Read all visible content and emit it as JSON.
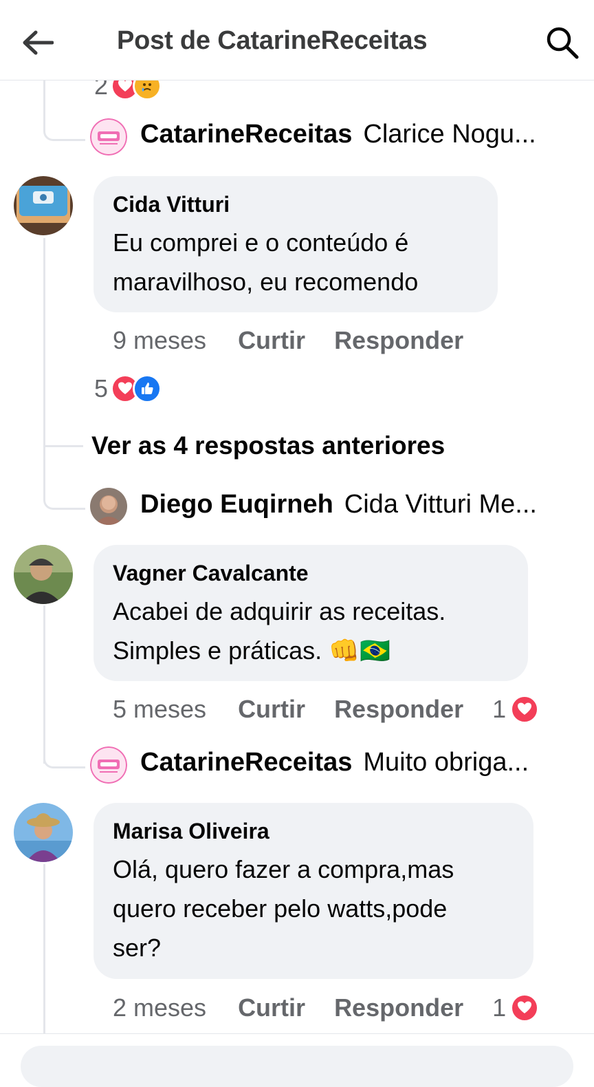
{
  "header": {
    "title": "Post de CatarineReceitas"
  },
  "top_partial": {
    "reaction_count": "2"
  },
  "replies": {
    "catarine_1": {
      "name": "CatarineReceitas",
      "text": "Clarice Nogu..."
    },
    "diego": {
      "name": "Diego Euqirneh",
      "text": "Cida Vitturi Me..."
    },
    "catarine_2": {
      "name": "CatarineReceitas",
      "text": "Muito obriga..."
    }
  },
  "comments": [
    {
      "author": "Cida Vitturi",
      "line1": "Eu comprei e o conteúdo é",
      "line2": "maravilhoso, eu recomendo",
      "time": "9 meses",
      "like": "Curtir",
      "reply": "Responder",
      "reaction_count": "5"
    },
    {
      "author": "Vagner Cavalcante",
      "line1": "Acabei de adquirir as receitas.",
      "line2": "Simples e práticas. 👊🇧🇷",
      "time": "5 meses",
      "like": "Curtir",
      "reply": "Responder",
      "reaction_count": "1"
    },
    {
      "author": "Marisa Oliveira",
      "line1": "Olá, quero fazer a compra,mas",
      "line2": "quero receber pelo watts,pode",
      "line3": "ser?",
      "time": "2 meses",
      "like": "Curtir",
      "reply": "Responder",
      "reaction_count": "1"
    }
  ],
  "view_previous": "Ver as 4 respostas anteriores",
  "colors": {
    "bubble": "#f0f2f5",
    "muted": "#65676b",
    "love": "#f33e58",
    "like": "#1877f2"
  }
}
